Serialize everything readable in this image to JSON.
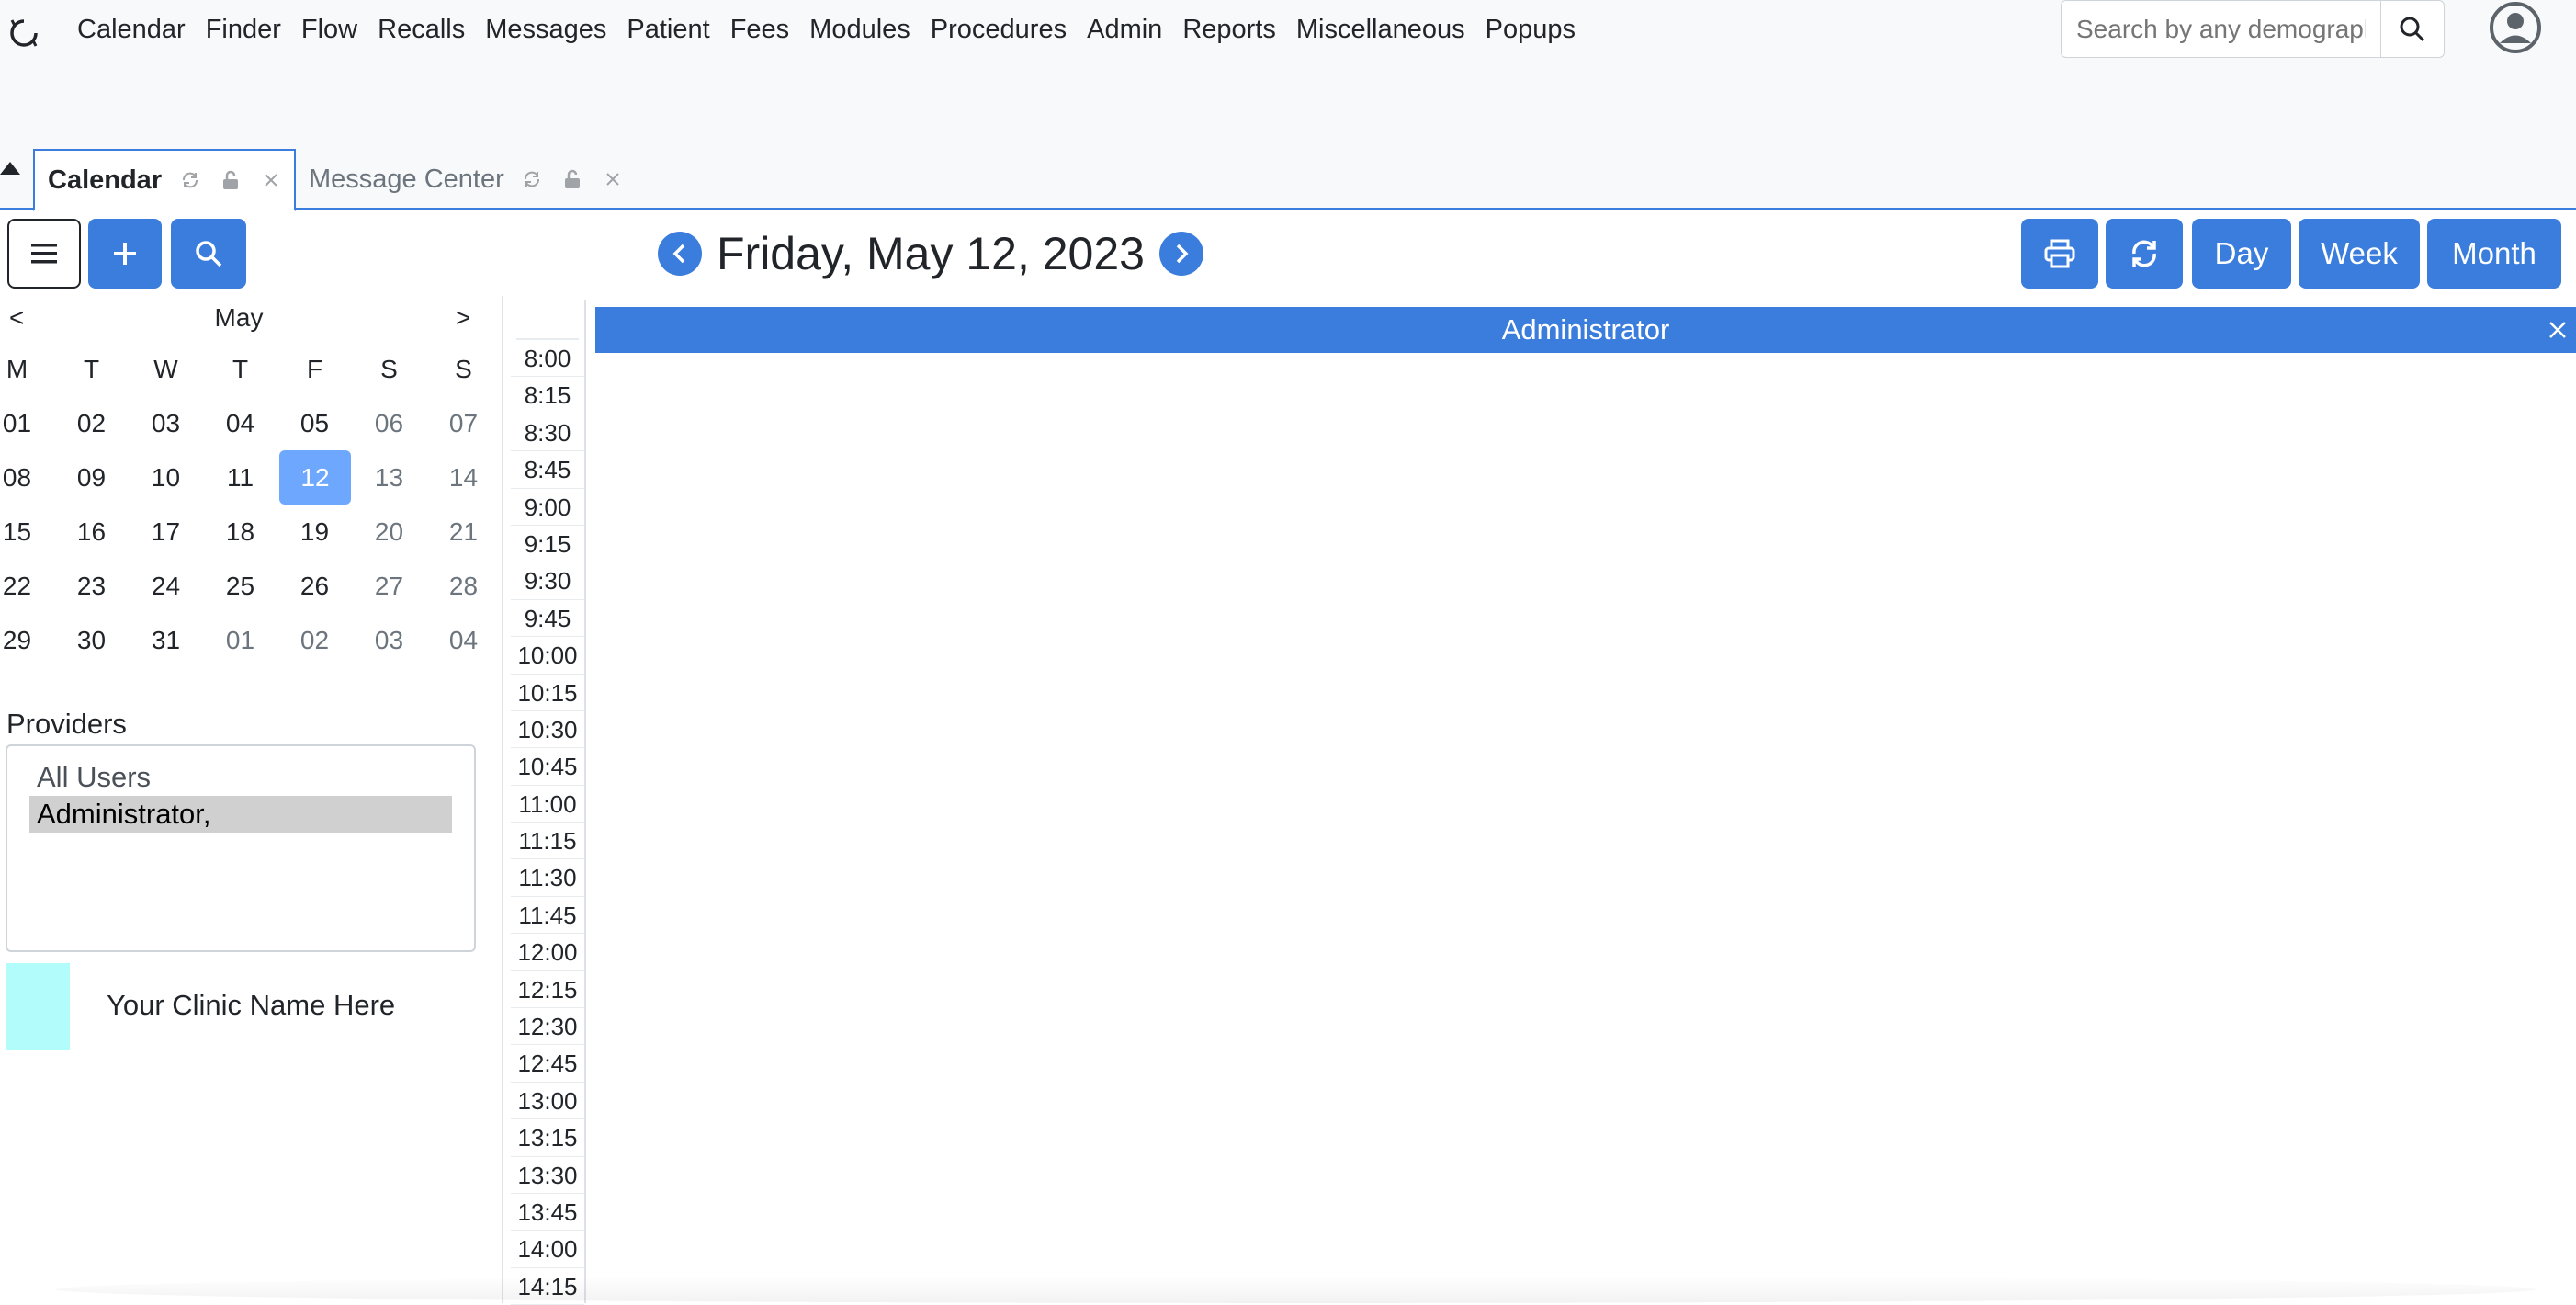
{
  "nav": {
    "items": [
      "Calendar",
      "Finder",
      "Flow",
      "Recalls",
      "Messages",
      "Patient",
      "Fees",
      "Modules",
      "Procedures",
      "Admin",
      "Reports",
      "Miscellaneous",
      "Popups"
    ],
    "search_placeholder": "Search by any demographics"
  },
  "tabs": [
    {
      "label": "Calendar",
      "active": true
    },
    {
      "label": "Message Center",
      "active": false
    }
  ],
  "toolbar": {
    "date_title": "Friday, May 12, 2023",
    "day_label": "Day",
    "week_label": "Week",
    "month_label": "Month"
  },
  "mini_calendar": {
    "prev": "<",
    "month": "May",
    "next": ">",
    "weekdays": [
      "M",
      "T",
      "W",
      "T",
      "F",
      "S",
      "S"
    ],
    "weeks": [
      [
        "01",
        "02",
        "03",
        "04",
        "05",
        "06",
        "07"
      ],
      [
        "08",
        "09",
        "10",
        "11",
        "12",
        "13",
        "14"
      ],
      [
        "15",
        "16",
        "17",
        "18",
        "19",
        "20",
        "21"
      ],
      [
        "22",
        "23",
        "24",
        "25",
        "26",
        "27",
        "28"
      ],
      [
        "29",
        "30",
        "31",
        "01",
        "02",
        "03",
        "04"
      ]
    ],
    "selected": "12"
  },
  "providers": {
    "label": "Providers",
    "options": [
      "All Users",
      "Administrator,"
    ],
    "selected": "Administrator,"
  },
  "clinic": {
    "name": "Your Clinic Name Here",
    "color": "#b3fcfc"
  },
  "schedule": {
    "provider_name": "Administrator",
    "times": [
      "8:00",
      "8:15",
      "8:30",
      "8:45",
      "9:00",
      "9:15",
      "9:30",
      "9:45",
      "10:00",
      "10:15",
      "10:30",
      "10:45",
      "11:00",
      "11:15",
      "11:30",
      "11:45",
      "12:00",
      "12:15",
      "12:30",
      "12:45",
      "13:00",
      "13:15",
      "13:30",
      "13:45",
      "14:00",
      "14:15"
    ]
  },
  "colors": {
    "accent": "#3b7ddd",
    "selected_day": "#6ea8fe"
  }
}
